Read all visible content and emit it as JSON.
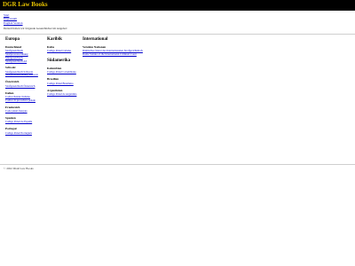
{
  "header": {
    "brand": "DGR Law Books"
  },
  "subnav": [
    "Start",
    "Impressum",
    "English Version"
  ],
  "intro": "Derzeit haben wir folgende Gesetzbücher im Angebot:",
  "europa": {
    "title": "Europa",
    "countries": [
      {
        "name": "Deutschland",
        "links": [
          "Strafgesetzbuch",
          "Strafprozessordnung",
          "Mietgesetzbuch",
          "Strafgesetzbuch AT"
        ]
      },
      {
        "name": "Schweiz",
        "links": [
          "Strafgesetzbuch Schweiz",
          "Strafprozessordnung Schweiz"
        ]
      },
      {
        "name": "Österreich",
        "links": [
          "Strafgesetzbuch Österreich"
        ]
      },
      {
        "name": "Italien",
        "links": [
          "Codice Penale Italiano",
          "Codice di procedura penale"
        ]
      },
      {
        "name": "Frankreich",
        "links": [
          "Code pénal français"
        ]
      },
      {
        "name": "Spanien",
        "links": [
          "Código Penal de España"
        ]
      },
      {
        "name": "Portugal",
        "links": [
          "Código Penal Português"
        ]
      }
    ]
  },
  "karibik": {
    "title": "Karibik",
    "countries": [
      {
        "name": "Kuba",
        "links": [
          "Código Penal Cubano"
        ]
      }
    ]
  },
  "suedamerika": {
    "title": "Südamerika",
    "countries": [
      {
        "name": "Kolumbien",
        "links": [
          "Código Penal Colombiano"
        ]
      },
      {
        "name": "Brasilien",
        "links": [
          "Código Penal Brasileiro"
        ]
      },
      {
        "name": "Argentinien",
        "links": [
          "Código Penal de Argentina"
        ]
      }
    ]
  },
  "international": {
    "title": "International",
    "countries": [
      {
        "name": "Vereinte Nationen",
        "links": [
          "Römisches Statut des Internationalen Strafgerichtshofs",
          "Rome Statute of the International Criminal Court"
        ]
      }
    ]
  },
  "footer": "© 2022 DGR Law Books"
}
